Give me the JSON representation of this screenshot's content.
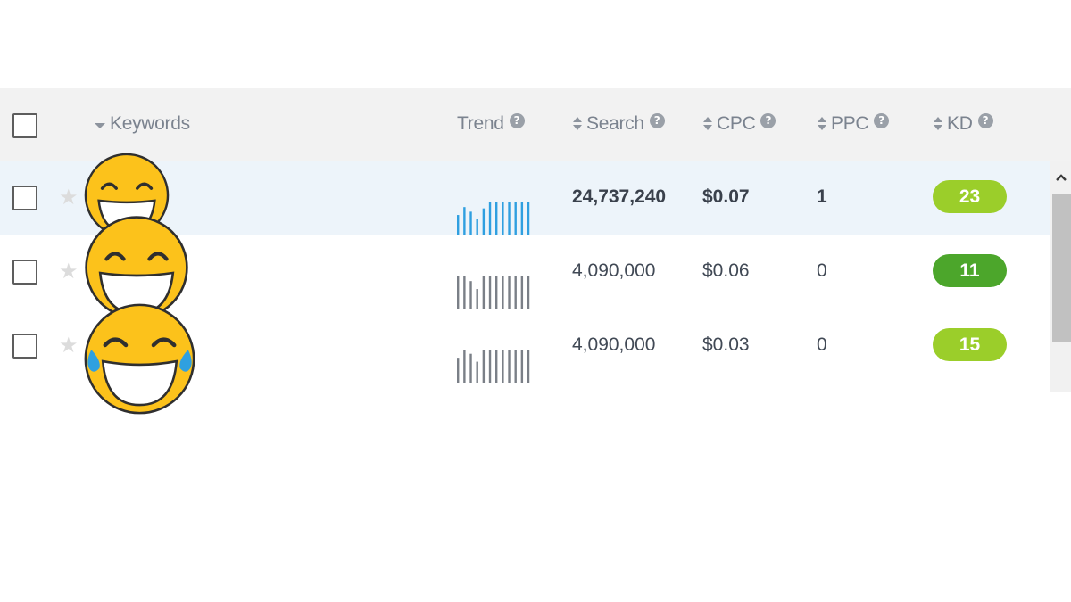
{
  "header": {
    "keywords_label": "Keywords",
    "trend_label": "Trend",
    "search_label": "Search",
    "cpc_label": "CPC",
    "ppc_label": "PPC",
    "kd_label": "KD"
  },
  "icons": {
    "help": "?",
    "star": "★",
    "scroll_up": "chevron-up-icon"
  },
  "colors": {
    "trend_active": "#2f9fe0",
    "trend_inactive": "#7a7f87",
    "kd_light_green": "#9bce2a",
    "kd_dark_green": "#4ca62b",
    "emoji_yellow": "#fcc21b"
  },
  "rows": [
    {
      "keyword": "",
      "search": "24,737,240",
      "cpc": "$0.07",
      "ppc": "1",
      "kd": "23",
      "kd_color": "#9bce2a",
      "trend_color": "#2f9fe0",
      "trend": [
        0.62,
        0.86,
        0.72,
        0.5,
        0.82,
        1.0,
        1.0,
        1.0,
        1.0,
        1.0,
        1.0,
        1.0
      ],
      "emoji": "grinning-face-icon"
    },
    {
      "keyword": "",
      "search": "4,090,000",
      "cpc": "$0.06",
      "ppc": "0",
      "kd": "11",
      "kd_color": "#4ca62b",
      "trend_color": "#7a7f87",
      "trend": [
        1.0,
        1.0,
        0.86,
        0.62,
        1.0,
        1.0,
        1.0,
        1.0,
        1.0,
        1.0,
        1.0,
        1.0
      ],
      "emoji": "grinning-face-icon"
    },
    {
      "keyword": "",
      "search": "4,090,000",
      "cpc": "$0.03",
      "ppc": "0",
      "kd": "15",
      "kd_color": "#9bce2a",
      "trend_color": "#7a7f87",
      "trend": [
        0.78,
        1.0,
        0.9,
        0.66,
        1.0,
        1.0,
        1.0,
        1.0,
        1.0,
        1.0,
        1.0,
        1.0
      ],
      "emoji": "face-with-tears-of-joy-icon"
    }
  ]
}
